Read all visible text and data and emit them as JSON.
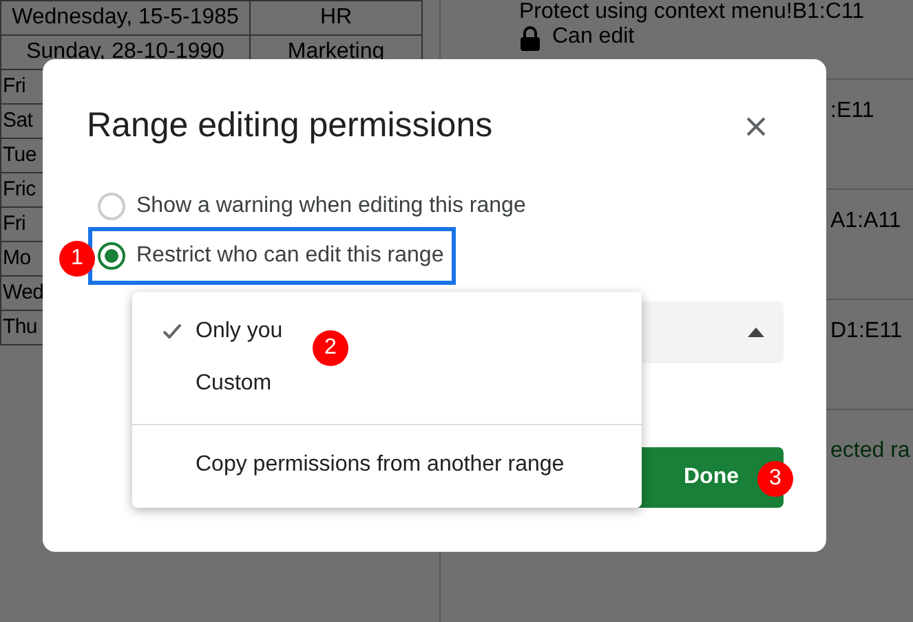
{
  "spreadsheet": {
    "rows": [
      {
        "column_1": "Wednesday, 15-5-1985",
        "column_2": "HR"
      },
      {
        "column_1": "Sunday, 28-10-1990",
        "column_2": "Marketing"
      },
      {
        "column_1": "Fri"
      },
      {
        "column_1": "Sat"
      },
      {
        "column_1": "Tue"
      },
      {
        "column_1": "Fric"
      },
      {
        "column_1": "Fri"
      },
      {
        "column_1": "Mo"
      },
      {
        "column_1": "Wed"
      },
      {
        "column_1": "Thu"
      }
    ]
  },
  "side_panel": {
    "items": [
      {
        "title": "Protect using context menu!B1:C11",
        "permission": "Can edit"
      },
      {
        "title": ":E11"
      },
      {
        "title": "A1:A11"
      },
      {
        "title": "D1:E11"
      }
    ],
    "status": "ected ra"
  },
  "dialog": {
    "title": "Range editing permissions",
    "options": [
      {
        "label": "Show a warning when editing this range",
        "selected": false,
        "highlighted": false
      },
      {
        "label": "Restrict who can edit this range",
        "selected": true,
        "highlighted": true
      }
    ],
    "menu": {
      "items": [
        {
          "label": "Only you",
          "checked": true
        },
        {
          "label": "Custom",
          "checked": false
        }
      ],
      "footer_item": "Copy permissions from another range"
    },
    "done_button": "Done"
  },
  "annotations": [
    {
      "label": "1"
    },
    {
      "label": "2"
    },
    {
      "label": "3"
    }
  ]
}
